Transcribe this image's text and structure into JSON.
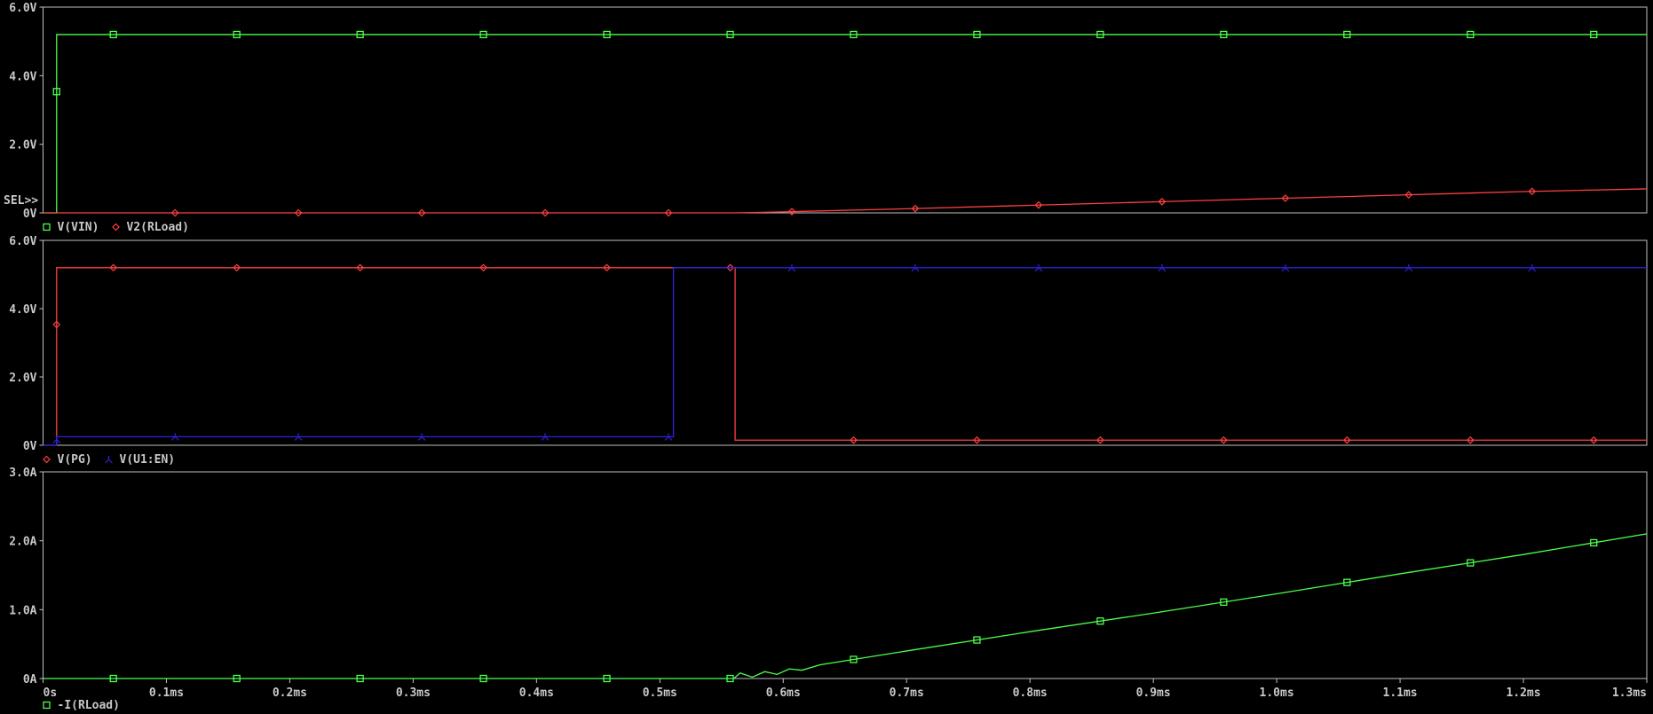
{
  "colors": {
    "axis": "#c0c0c0",
    "green": "#4cff4c",
    "red": "#ff4040",
    "blue": "#3020e0",
    "text": "#c8c8c8"
  },
  "sel_marker": "SEL>>",
  "chart_data": [
    {
      "type": "line",
      "ylim": [
        0,
        6
      ],
      "yticks": [
        "0V",
        "2.0V",
        "4.0V",
        "6.0V"
      ],
      "ytick_values": [
        0,
        2,
        4,
        6
      ],
      "legend": [
        "V(VIN)",
        "V2(RLoad)"
      ],
      "series": [
        {
          "name": "V(VIN)",
          "color": "green",
          "marker": "square",
          "points": [
            [
              0,
              0
            ],
            [
              0.011,
              0
            ],
            [
              0.011,
              5.2
            ],
            [
              1.3,
              5.2
            ]
          ]
        },
        {
          "name": "V2(RLoad)",
          "color": "red",
          "marker": "diamond",
          "points": [
            [
              0,
              0
            ],
            [
              0.56,
              0
            ],
            [
              0.6,
              0.03
            ],
            [
              0.7,
              0.12
            ],
            [
              0.8,
              0.22
            ],
            [
              0.9,
              0.32
            ],
            [
              1.0,
              0.42
            ],
            [
              1.1,
              0.52
            ],
            [
              1.2,
              0.62
            ],
            [
              1.3,
              0.7
            ]
          ]
        }
      ]
    },
    {
      "type": "line",
      "ylim": [
        0,
        6
      ],
      "yticks": [
        "0V",
        "2.0V",
        "4.0V",
        "6.0V"
      ],
      "ytick_values": [
        0,
        2,
        4,
        6
      ],
      "legend": [
        "V(PG)",
        "V(U1:EN)"
      ],
      "series": [
        {
          "name": "V(PG)",
          "color": "red",
          "marker": "diamond",
          "points": [
            [
              0,
              0
            ],
            [
              0.011,
              0
            ],
            [
              0.011,
              5.2
            ],
            [
              0.561,
              5.2
            ],
            [
              0.561,
              0.15
            ],
            [
              1.3,
              0.15
            ]
          ]
        },
        {
          "name": "V(U1:EN)",
          "color": "blue",
          "marker": "tri",
          "points": [
            [
              0,
              0
            ],
            [
              0.011,
              0
            ],
            [
              0.011,
              0.25
            ],
            [
              0.511,
              0.25
            ],
            [
              0.511,
              5.2
            ],
            [
              1.3,
              5.2
            ]
          ]
        }
      ]
    },
    {
      "type": "line",
      "ylim": [
        0,
        3
      ],
      "yticks": [
        "0A",
        "1.0A",
        "2.0A",
        "3.0A"
      ],
      "ytick_values": [
        0,
        1,
        2,
        3
      ],
      "legend": [
        "-I(RLoad)"
      ],
      "series": [
        {
          "name": "-I(RLoad)",
          "color": "green",
          "marker": "square",
          "points": [
            [
              0,
              0
            ],
            [
              0.56,
              0
            ],
            [
              0.565,
              0.08
            ],
            [
              0.575,
              0.02
            ],
            [
              0.585,
              0.1
            ],
            [
              0.595,
              0.06
            ],
            [
              0.605,
              0.14
            ],
            [
              0.615,
              0.12
            ],
            [
              0.63,
              0.2
            ],
            [
              0.7,
              0.4
            ],
            [
              0.8,
              0.68
            ],
            [
              0.9,
              0.95
            ],
            [
              1.0,
              1.23
            ],
            [
              1.1,
              1.52
            ],
            [
              1.2,
              1.8
            ],
            [
              1.3,
              2.1
            ]
          ]
        }
      ]
    }
  ],
  "xaxis": {
    "xlim": [
      0,
      1.3
    ],
    "tick_values": [
      0,
      0.1,
      0.2,
      0.3,
      0.4,
      0.5,
      0.6,
      0.7,
      0.8,
      0.9,
      1.0,
      1.1,
      1.2,
      1.3
    ],
    "ticks": [
      "0s",
      "0.1ms",
      "0.2ms",
      "0.3ms",
      "0.4ms",
      "0.5ms",
      "0.6ms",
      "0.7ms",
      "0.8ms",
      "0.9ms",
      "1.0ms",
      "1.1ms",
      "1.2ms",
      "1.3ms"
    ]
  }
}
